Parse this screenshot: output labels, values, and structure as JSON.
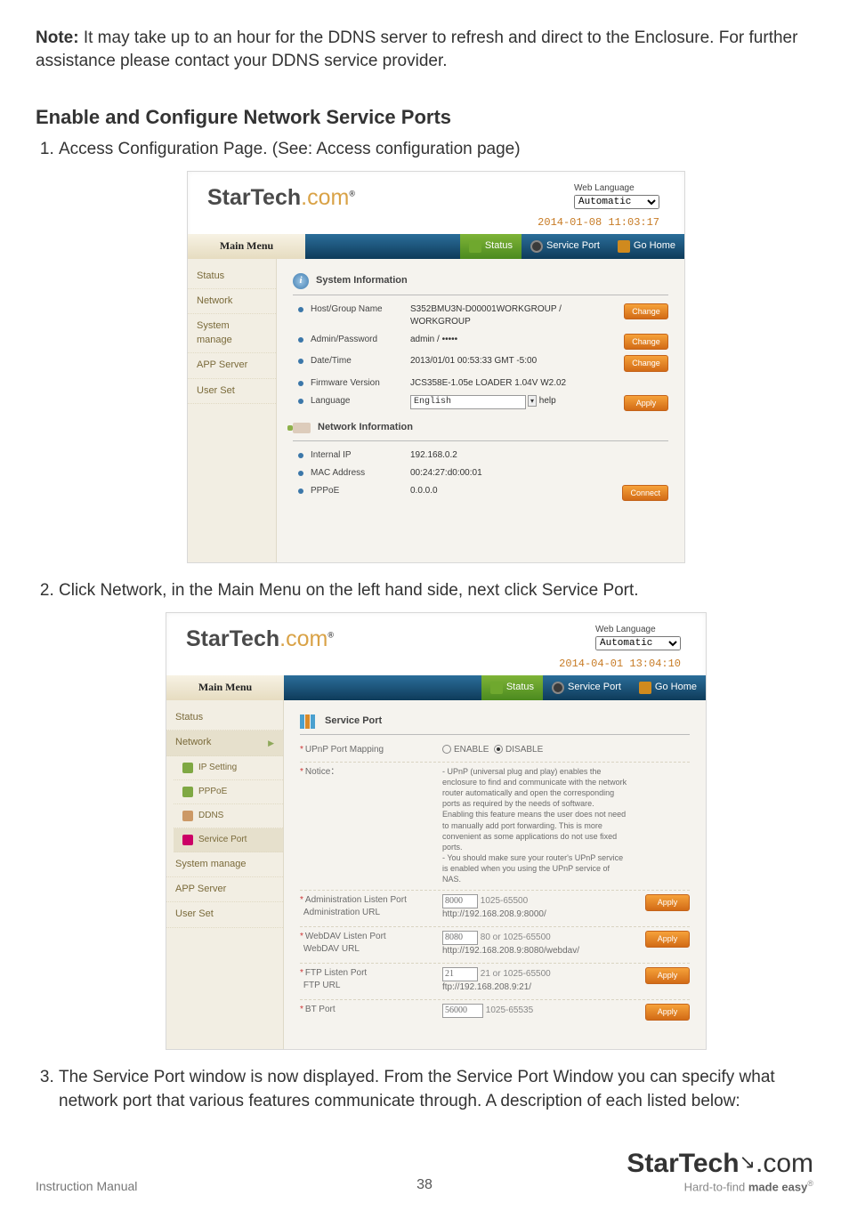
{
  "note_label": "Note:",
  "note_text": " It may take up to an hour for the DDNS server to refresh and direct to the Enclosure. For further assistance please contact your DDNS service provider.",
  "h2": "Enable and Configure Network Service Ports",
  "steps": {
    "s1": "Access Configuration Page. (See: Access configuration page)",
    "s2": "Click Network, in the Main Menu on the left hand side, next click Service Port.",
    "s3": "The Service Port window is now displayed.  From the Service Port Window you can specify what network port that various features communicate through. A description of each listed below:"
  },
  "shot1": {
    "brand1": "StarTech",
    "brand2": ".com",
    "weblang_lbl": "Web Language",
    "weblang_val": "Automatic",
    "datetime": "2014-01-08 11:03:17",
    "mm": "Main Menu",
    "tab_status": "Status",
    "tab_sp": "Service Port",
    "tab_home": "Go Home",
    "side": {
      "status": "Status",
      "network": "Network",
      "sysman": "System manage",
      "app": "APP Server",
      "user": "User Set"
    },
    "sysinfo_title": "System Information",
    "rows": {
      "host_lbl": "Host/Group Name",
      "host_val": "S352BMU3N-D00001WORKGROUP / WORKGROUP",
      "adm_lbl": "Admin/Password",
      "adm_val": "admin / •••••",
      "dt_lbl": "Date/Time",
      "dt_val": "2013/01/01 00:53:33 GMT -5:00",
      "fw_lbl": "Firmware Version",
      "fw_val": "JCS358E-1.05e LOADER 1.04V W2.02",
      "lang_lbl": "Language",
      "lang_val": "English",
      "lang_help": "help"
    },
    "btn_change": "Change",
    "btn_apply": "Apply",
    "btn_connect": "Connect",
    "netinfo_title": "Network Information",
    "net": {
      "ip_lbl": "Internal IP",
      "ip_val": "192.168.0.2",
      "mac_lbl": "MAC Address",
      "mac_val": "00:24:27:d0:00:01",
      "ppp_lbl": "PPPoE",
      "ppp_val": "0.0.0.0"
    }
  },
  "shot2": {
    "brand1": "StarTech",
    "brand2": ".com",
    "weblang_lbl": "Web Language",
    "weblang_val": "Automatic",
    "datetime": "2014-04-01 13:04:10",
    "mm": "Main Menu",
    "tab_status": "Status",
    "tab_sp": "Service Port",
    "tab_home": "Go Home",
    "side": {
      "status": "Status",
      "network": "Network",
      "ip": "IP Setting",
      "pppoe": "PPPoE",
      "ddns": "DDNS",
      "sp": "Service Port",
      "sysman": "System manage",
      "app": "APP Server",
      "user": "User Set"
    },
    "sp_title": "Service Port",
    "upnp_lbl": "UPnP Port Mapping",
    "enable": "ENABLE",
    "disable": "DISABLE",
    "notice_lbl": "Notice：",
    "notice_txt": "- UPnP (universal plug and play) enables the enclosure to find and communicate with the network router automatically and open the corresponding ports as required by the needs of software. Enabling this feature means the user does not need to manually add port forwarding. This is more convenient as some applications do not use fixed ports.\n- You should make sure your router's UPnP service is enabled when you using the UPnP service of NAS.",
    "rows": {
      "admin_port_lbl": "Administration Listen Port",
      "admin_port_val": "8000",
      "admin_port_range": "1025-65500",
      "admin_url_lbl": "Administration URL",
      "admin_url_val": "http://192.168.208.9:8000/",
      "webdav_port_lbl": "WebDAV Listen Port",
      "webdav_port_val": "8080",
      "webdav_port_range": "80 or 1025-65500",
      "webdav_url_lbl": "WebDAV URL",
      "webdav_url_val": "http://192.168.208.9:8080/webdav/",
      "ftp_port_lbl": "FTP Listen Port",
      "ftp_port_val": "21",
      "ftp_port_range": "21 or 1025-65500",
      "ftp_url_lbl": "FTP URL",
      "ftp_url_val": "ftp://192.168.208.9:21/",
      "bt_port_lbl": "BT Port",
      "bt_port_val": "56000",
      "bt_port_range": "1025-65535"
    },
    "btn_apply": "Apply"
  },
  "footer": {
    "im": "Instruction Manual",
    "page": "38",
    "logo1": "StarTech",
    "logo2": ".com",
    "tag_pre": "Hard-to-find ",
    "tag_b": "made easy",
    "reg": "®"
  }
}
